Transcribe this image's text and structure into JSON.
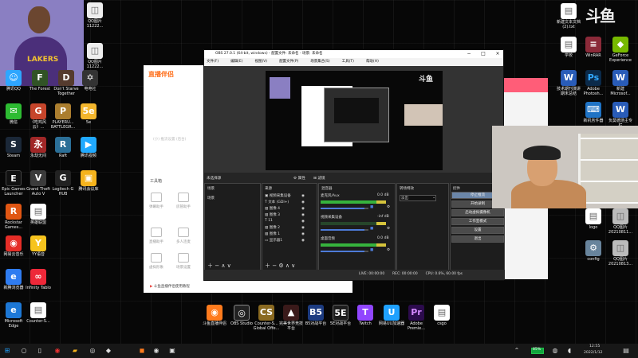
{
  "desktop": {
    "icons": [
      {
        "label": "QQ图片 11222...",
        "glyph": "◫",
        "color": "#eeeeee"
      },
      {
        "label": "QQ图片 11222...",
        "glyph": "◫",
        "color": "#eeeeee"
      },
      {
        "label": "腾讯QQ",
        "glyph": "☺",
        "color": "#2ea6ff"
      },
      {
        "label": "The Forest",
        "glyph": "F",
        "color": "#315326"
      },
      {
        "label": "Don't Starve Together",
        "glyph": "D",
        "color": "#553b2e"
      },
      {
        "label": "电电社",
        "glyph": "✡",
        "color": "#333333"
      },
      {
        "label": "微信",
        "glyph": "✉",
        "color": "#2dbb32"
      },
      {
        "label": "《吃鸡风云》...",
        "glyph": "G",
        "color": "#c6452b"
      },
      {
        "label": "PLAYERU... BATTLEGR...",
        "glyph": "P",
        "color": "#ab7e2f"
      },
      {
        "label": "5e",
        "glyph": "5e",
        "color": "#f3b62d"
      },
      {
        "label": "Steam",
        "glyph": "S",
        "color": "#1b2838"
      },
      {
        "label": "永劫无间",
        "glyph": "永",
        "color": "#a02727"
      },
      {
        "label": "Raft",
        "glyph": "R",
        "color": "#2b6f97"
      },
      {
        "label": "腾讯视频",
        "glyph": "▶",
        "color": "#20a9ff"
      },
      {
        "label": "Epic Games Launcher",
        "glyph": "E",
        "color": "#111111"
      },
      {
        "label": "Grand Theft Auto V",
        "glyph": "V",
        "color": "#3b3b3b"
      },
      {
        "label": "Logitech G HUB",
        "glyph": "G",
        "color": "#222222"
      },
      {
        "label": "腾讯会议库",
        "glyph": "▣",
        "color": "#f5b31d"
      },
      {
        "label": "Rockstar Games...",
        "glyph": "R",
        "color": "#e05613"
      },
      {
        "label": "英雄联盟",
        "glyph": "▤",
        "color": "#ffffff"
      },
      {
        "label": "网易云音乐",
        "glyph": "◉",
        "color": "#e52d27"
      },
      {
        "label": "YY语音",
        "glyph": "Y",
        "color": "#f7c41e"
      },
      {
        "label": "新腾浏览器",
        "glyph": "e",
        "color": "#2f7cf0"
      },
      {
        "label": "Infinity Tablo",
        "glyph": "∞",
        "color": "#ee2839"
      },
      {
        "label": "Microsoft Edge",
        "glyph": "e",
        "color": "#1d78d6"
      },
      {
        "label": "Counter-S...",
        "glyph": "▤",
        "color": "#ffffff"
      },
      {
        "label": "新建文本文档 (2).txt",
        "glyph": "▤",
        "color": "#ffffff"
      },
      {
        "label": "学校",
        "glyph": "▤",
        "color": "#ffffff"
      },
      {
        "label": "WinRAR",
        "glyph": "≡",
        "color": "#8b2a39"
      },
      {
        "label": "GeForce Experience",
        "glyph": "◆",
        "color": "#77b900"
      },
      {
        "label": "技术期刊演讲 期末总结",
        "glyph": "W",
        "color": "#295cb8"
      },
      {
        "label": "Adobe Photosh...",
        "glyph": "Ps",
        "color": "#0b2a4a"
      },
      {
        "label": "新建 Microsof...",
        "glyph": "W",
        "color": "#295cb8"
      },
      {
        "label": "新机务件器",
        "glyph": "⌨",
        "color": "#1f73c5"
      },
      {
        "label": "负莫德场主专栏",
        "glyph": "W",
        "color": "#295cb8"
      },
      {
        "label": "logo",
        "glyph": "▤",
        "color": "#ffffff"
      },
      {
        "label": "QQ图片 20210811...",
        "glyph": "◫",
        "color": "#bbbbbb"
      },
      {
        "label": "config",
        "glyph": "⚙",
        "color": "#68849c"
      },
      {
        "label": "QQ图片 20210813...",
        "glyph": "◫",
        "color": "#bbbbbb"
      },
      {
        "label": "斗鱼直播伴侣",
        "glyph": "◉",
        "color": "#ff7b1d"
      },
      {
        "label": "OBS Studio",
        "glyph": "◎",
        "color": "#222222"
      },
      {
        "label": "Counter-S... Global Offe...",
        "glyph": "CS",
        "color": "#8a6a21"
      },
      {
        "label": "完美世界竞技 平台",
        "glyph": "▲",
        "color": "#3a1a1a"
      },
      {
        "label": "B5对战平台",
        "glyph": "B5",
        "color": "#1c3b80"
      },
      {
        "label": "5E对战平台",
        "glyph": "5E",
        "color": "#1d1d1d"
      },
      {
        "label": "Twitch",
        "glyph": "T",
        "color": "#9146ff"
      },
      {
        "label": "网易UU加速器",
        "glyph": "U",
        "color": "#1fa1ff"
      },
      {
        "label": "Adobe Premie...",
        "glyph": "Pr",
        "color": "#2c0b4d"
      },
      {
        "label": "csgo",
        "glyph": "▤",
        "color": "#ffffff"
      }
    ]
  },
  "streamer": {
    "logo": "直播伴侣",
    "tool_title": "工具箱",
    "tools": [
      "弹幕助手",
      "房管助手",
      "直播助手",
      "多人连麦",
      "虚拟形象",
      "场景设置"
    ],
    "footer": "斗鱼直播伴侣使用教程",
    "blank_hint": "(小) 推流设置 (后台)"
  },
  "obs": {
    "title": "OBS 27.0.1 (64-bit, windows) - 配置文件: 未命名 - 场景: 未命名",
    "menu": [
      "文件(F)",
      "编辑(E)",
      "视图(V)",
      "配置文件(P)",
      "场景集合(S)",
      "工具(T)",
      "帮助(H)"
    ],
    "scene_dock_title": "未选择源",
    "properties": "属性",
    "filters": "滤镜",
    "scenes_title": "场景",
    "scene_item": "场景",
    "sources_title": "来源",
    "sources": [
      "视频采集设备",
      "文本 (GDI+)",
      "图像 4",
      "图像 3",
      "11",
      "图像 2",
      "图像 1",
      "显示器1"
    ],
    "mixer_title": "混音器",
    "mixer": [
      {
        "name": "麦克风/Aux",
        "db": "0.0 dB"
      },
      {
        "name": "视频采集设备",
        "db": "-inf dB"
      },
      {
        "name": "桌面音频",
        "db": "0.0 dB"
      }
    ],
    "transition_title": "转场特效",
    "transition_value": "淡出",
    "controls_title": "控件",
    "controls": [
      "停止推流",
      "开始录制",
      "启动虚拟摄像机",
      "工作室模式",
      "设置",
      "退出"
    ],
    "status": {
      "live": "LIVE: 00:00:00",
      "rec": "REC: 00:00:00",
      "cpu": "CPU: 0.6%, 60.00 fps"
    }
  },
  "taskbar": {
    "time": "12:55",
    "date": "2022/1/12",
    "battery": "85%"
  }
}
